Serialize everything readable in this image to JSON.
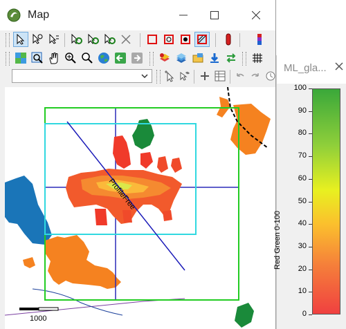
{
  "window": {
    "title": "Map",
    "minimize_icon": "minimize-icon",
    "maximize_icon": "maximize-icon",
    "close_icon": "close-icon"
  },
  "toolbar": {
    "row1_icons": [
      "select-arrow-icon",
      "select-node-icon",
      "select-point-icon",
      "rotate-icon",
      "rotate-node-icon",
      "rotate-point-icon",
      "delete-x-icon",
      "rect-red-icon",
      "rect-zoom-icon",
      "gear-red-icon",
      "hatch-rect-icon",
      "pencil-red-icon",
      "pencil-color-icon"
    ],
    "row2_icons": [
      "layer-grid-icon",
      "zoom-layer-icon",
      "pan-hand-icon",
      "zoom-in-icon",
      "zoom-icon",
      "globe-icon",
      "back-arrow-icon",
      "forward-arrow-icon",
      "layers-add-icon",
      "layers-stack-icon",
      "folder-layer-icon",
      "download-icon",
      "swap-icon",
      "grid-icon"
    ],
    "row3_icons": [
      "cursor-plus-icon",
      "cursor-wave-icon",
      "plus-icon",
      "table-icon",
      "undo-icon",
      "redo-icon",
      "clock-icon"
    ],
    "combo_value": ""
  },
  "map": {
    "feature_label": "ProfileFree",
    "scale_label": "1000"
  },
  "legend_panel": {
    "title": "ML_gla...",
    "caption": "Red Green 0-100",
    "ticks": [
      "100",
      "90",
      "80",
      "70",
      "60",
      "50",
      "40",
      "30",
      "20",
      "10",
      "0"
    ]
  }
}
